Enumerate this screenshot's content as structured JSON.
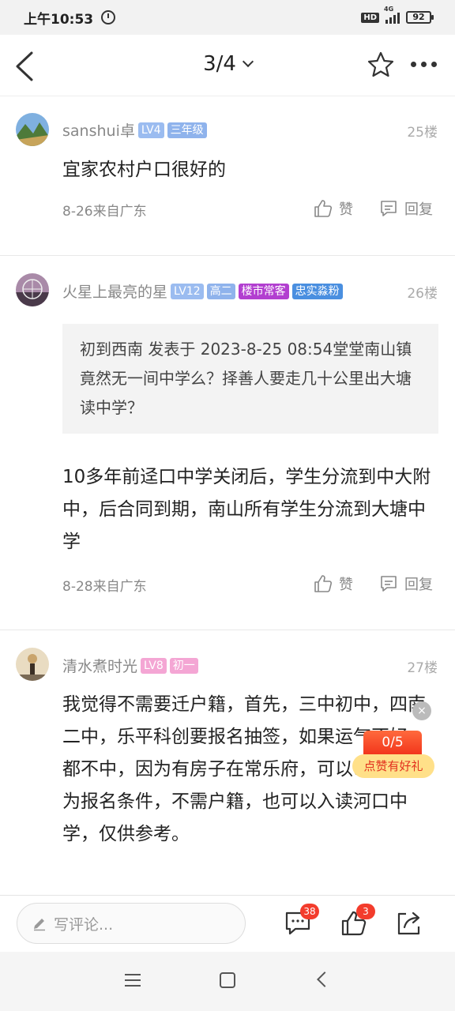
{
  "status_bar": {
    "time": "上午10:53",
    "hd": "HD",
    "network": "4G",
    "battery": "92"
  },
  "nav": {
    "page_indicator": "3/4",
    "icons": [
      "back-icon",
      "star-icon",
      "more-icon"
    ]
  },
  "posts": [
    {
      "username": "sanshui卓",
      "tags": [
        {
          "text": "LV4",
          "color": "#9bbcf0"
        },
        {
          "text": "三年级",
          "color": "#8fb3ec"
        }
      ],
      "floor": "25楼",
      "content": "宜家农村户口很好的",
      "meta": "8-26来自广东",
      "like_label": "赞",
      "reply_label": "回复"
    },
    {
      "username": "火星上最亮的星",
      "tags": [
        {
          "text": "LV12",
          "color": "#9bbcf0"
        },
        {
          "text": "高二",
          "color": "#8fb3ec"
        },
        {
          "text": "楼市常客",
          "color": "#b23fd0"
        },
        {
          "text": "忠实淼粉",
          "color": "#4a8fe0"
        }
      ],
      "floor": "26楼",
      "quote": "初到西南 发表于 2023-8-25 08:54堂堂南山镇竟然无一间中学么？择善人要走几十公里出大塘读中学？",
      "content": "10多年前迳口中学关闭后，学生分流到中大附中，后合同到期，南山所有学生分流到大塘中学",
      "meta": "8-28来自广东",
      "like_label": "赞",
      "reply_label": "回复"
    },
    {
      "username": "清水煮时光",
      "tags": [
        {
          "text": "LV8",
          "color": "#f4a6d4"
        },
        {
          "text": "初一",
          "color": "#f4a6d4"
        }
      ],
      "floor": "27楼",
      "content": "我觉得不需要迁户籍，首先，三中初中，四南二中，乐平科创要报名抽签，如果运气不好，都不中，因为有房子在常乐府，可以以房产作为报名条件，不需户籍，也可以入读河口中学，仅供参考。"
    }
  ],
  "reward": {
    "count": "0/5",
    "label": "点赞有好礼",
    "close": "×"
  },
  "bottom_bar": {
    "comment_placeholder": "写评论...",
    "comment_count": "38",
    "like_count": "3"
  }
}
